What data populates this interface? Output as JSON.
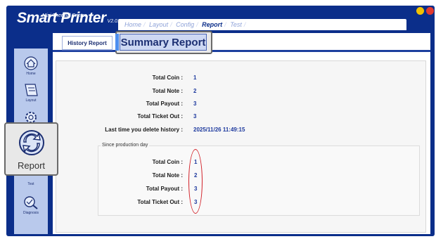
{
  "app": {
    "name": "Smart Printer",
    "version": "V2.0.27",
    "subtitle": "Mini Thermal Printer"
  },
  "top_nav": [
    {
      "label": "Home"
    },
    {
      "label": "Layout"
    },
    {
      "label": "Config"
    },
    {
      "label": "Report"
    },
    {
      "label": "Test"
    }
  ],
  "sidebar": {
    "items": [
      {
        "label": "Home",
        "icon": "home-icon"
      },
      {
        "label": "Layout",
        "icon": "layout-icon"
      },
      {
        "label": "Config",
        "icon": "config-gear-icon"
      },
      {
        "label": "Report",
        "icon": "report-icon"
      },
      {
        "label": "Test",
        "icon": "test-icon"
      },
      {
        "label": "Diagnosis",
        "icon": "diagnosis-icon"
      }
    ]
  },
  "tabs": {
    "history": "History Report",
    "summary": "Summary Report"
  },
  "summary": {
    "rows": [
      {
        "label": "Total Coin :",
        "value": "1"
      },
      {
        "label": "Total Note :",
        "value": "2"
      },
      {
        "label": "Total Payout :",
        "value": "3"
      },
      {
        "label": "Total Ticket Out :",
        "value": "3"
      }
    ],
    "last_delete_label": "Last time you delete history :",
    "last_delete_value": "2025/11/26 11:49:15"
  },
  "since_production": {
    "title": "Since production day",
    "rows": [
      {
        "label": "Total Coin :",
        "value": "1"
      },
      {
        "label": "Total Note :",
        "value": "2"
      },
      {
        "label": "Total Payout :",
        "value": "3"
      },
      {
        "label": "Total Ticket Out :",
        "value": "3"
      }
    ]
  },
  "colors": {
    "frame": "#0b2e8a",
    "sidebar": "#b9c9ec",
    "value_text": "#1e3a9e",
    "highlight_oval": "#d2222a"
  }
}
